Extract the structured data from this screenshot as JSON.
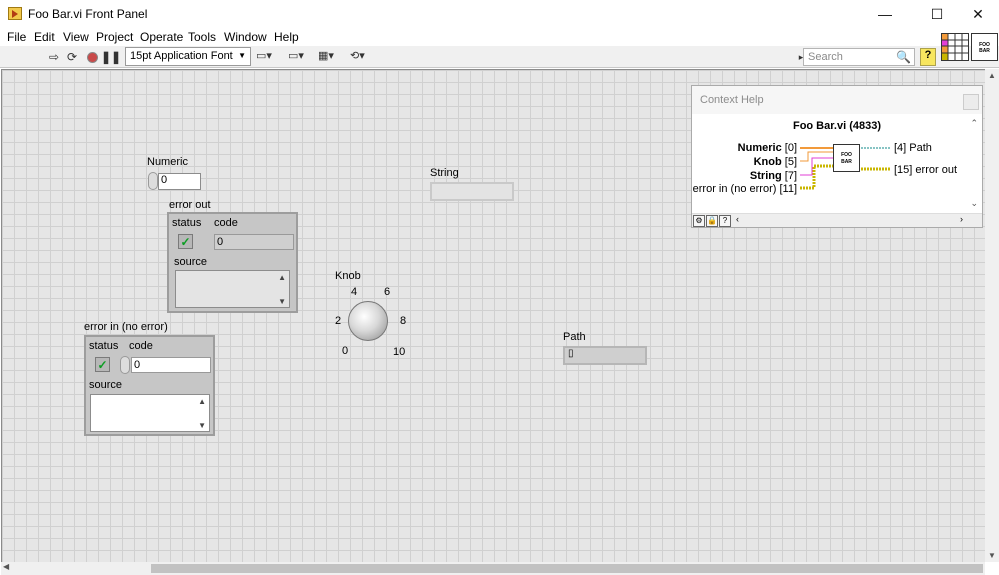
{
  "window": {
    "title": "Foo Bar.vi Front Panel",
    "minimize": "—",
    "maximize": "☐",
    "close": "✕"
  },
  "menu": {
    "items": [
      "File",
      "Edit",
      "View",
      "Project",
      "Operate",
      "Tools",
      "Window",
      "Help"
    ]
  },
  "toolbar": {
    "font": "15pt Application Font",
    "search_placeholder": "Search",
    "help_glyph": "?",
    "vi_icon_line1": "FOO",
    "vi_icon_line2": "BAR"
  },
  "panel": {
    "numeric": {
      "label": "Numeric",
      "value": "0"
    },
    "error_out": {
      "label": "error out",
      "status_label": "status",
      "code_label": "code",
      "code_value": "0",
      "source_label": "source"
    },
    "string": {
      "label": "String",
      "value": ""
    },
    "knob": {
      "label": "Knob",
      "ticks": [
        "0",
        "2",
        "4",
        "6",
        "8",
        "10"
      ]
    },
    "path": {
      "label": "Path",
      "value": ""
    },
    "error_in": {
      "label": "error in (no error)",
      "status_label": "status",
      "code_label": "code",
      "code_value": "0",
      "source_label": "source"
    }
  },
  "context_help": {
    "title": "Context Help",
    "vi_name": "Foo Bar.vi (4833)",
    "icon_line1": "FOO",
    "icon_line2": "BAR",
    "inputs": [
      {
        "name": "Numeric",
        "index": "[0]",
        "color": "#f29a3a"
      },
      {
        "name": "Knob",
        "index": "[5]",
        "color": "#f29a3a"
      },
      {
        "name": "String",
        "index": "[7]",
        "color": "#e23fd6"
      },
      {
        "name": "error in (no error)",
        "index": "[11]",
        "color": "#c9b600"
      }
    ],
    "outputs": [
      {
        "name": "Path",
        "index": "[4]",
        "color": "#0f8a8a"
      },
      {
        "name": "error out",
        "index": "[15]",
        "color": "#c9b600"
      }
    ]
  }
}
